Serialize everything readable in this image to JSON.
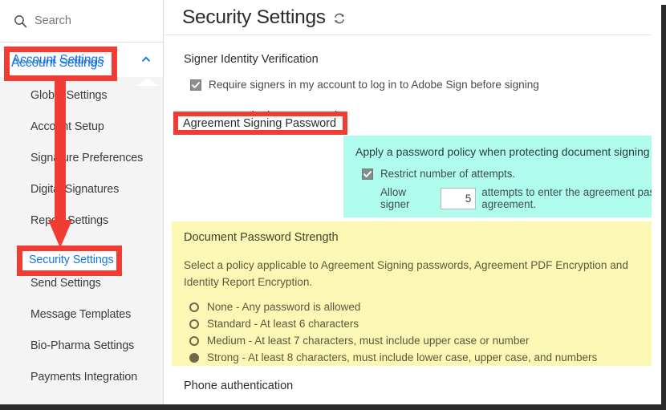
{
  "sidebar": {
    "search": {
      "name": "search",
      "placeholder": "Search",
      "value": "",
      "icon": "search-icon"
    },
    "account_settings": {
      "label": "Account Settings",
      "expanded": true,
      "chevron_icon": "chevron-up-icon",
      "color": "#1473e6"
    },
    "items": [
      {
        "label": "Global Settings",
        "selected": false
      },
      {
        "label": "Account Setup",
        "selected": false
      },
      {
        "label": "Signature Preferences",
        "selected": false
      },
      {
        "label": "Digital Signatures",
        "selected": false
      },
      {
        "label": "Report Settings",
        "selected": false
      },
      {
        "label": "Security Settings",
        "selected": true
      },
      {
        "label": "Send Settings",
        "selected": false
      },
      {
        "label": "Message Templates",
        "selected": false
      },
      {
        "label": "Bio-Pharma Settings",
        "selected": false
      },
      {
        "label": "Payments Integration",
        "selected": false
      }
    ]
  },
  "main": {
    "title": "Security Settings",
    "refresh_icon": "refresh-icon",
    "signer_identity": {
      "heading": "Signer Identity Verification",
      "checkbox": {
        "label": "Require signers in my account to log in to Adobe Sign before signing",
        "checked": true
      }
    },
    "agreement_signing_password": {
      "heading": "Agreement Signing Password",
      "panel_color": "#b0fcec",
      "policy_title": "Apply a password policy when protecting document signing or viewing",
      "restrict_checkbox": {
        "label": "Restrict number of attempts.",
        "checked": true
      },
      "allow_signer": {
        "prefix": "Allow signer",
        "attempts_value": "5",
        "suffix": "attempts to enter the agreement password before cancelling the agreement."
      }
    },
    "document_password_strength": {
      "heading": "Document Password Strength",
      "panel_color": "#fbf7b4",
      "description": "Select a policy applicable to Agreement Signing passwords, Agreement PDF Encryption and Identity Report Encryption.",
      "options": [
        {
          "label": "None - Any password is allowed",
          "selected": false
        },
        {
          "label": "Standard - At least 6 characters",
          "selected": false
        },
        {
          "label": "Medium - At least 7 characters, must include upper case or number",
          "selected": false
        },
        {
          "label": "Strong - At least 8 characters, must include lower case, upper case, and numbers",
          "selected": true
        }
      ]
    },
    "phone_authentication": {
      "heading": "Phone authentication"
    }
  },
  "annotations": {
    "color": "#f03c33",
    "highlight_account_settings": "Account Settings",
    "highlight_security_settings": "Security Settings",
    "highlight_agreement_signing_password": "Agreement Signing Password",
    "arrow_icon": "down-arrow-annotation-icon"
  }
}
